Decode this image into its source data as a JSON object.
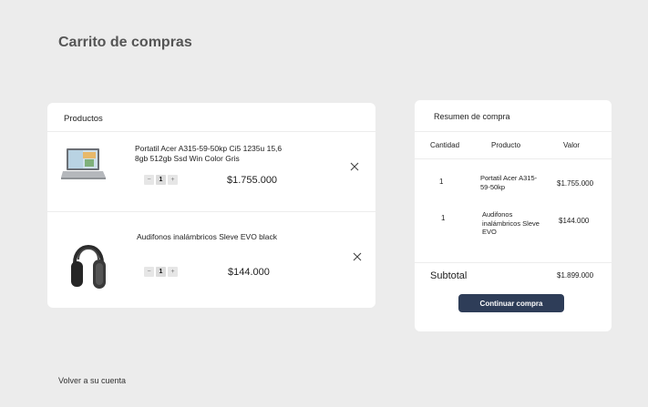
{
  "page": {
    "title": "Carrito de compras",
    "back_link": "Volver a  su cuenta"
  },
  "products": {
    "header": "Productos",
    "items": [
      {
        "name": "Portatil Acer A315-59-50kp Ci5 1235u 15,6 8gb 512gb Ssd Win Color Gris",
        "quantity": "1",
        "price": "$1.755.000",
        "image": "laptop-image"
      },
      {
        "name": "Audifonos inalámbricos Sleve EVO black",
        "quantity": "1",
        "price": "$144.000",
        "image": "headphones-image"
      }
    ],
    "minus_symbol": "−",
    "plus_symbol": "+"
  },
  "summary": {
    "title": "Resumen de compra",
    "columns": [
      "Cantidad",
      "Producto",
      "Valor"
    ],
    "rows": [
      {
        "qty": "1",
        "product": "Portatil Acer A315-59-50kp",
        "value": "$1.755.000"
      },
      {
        "qty": "1",
        "product": "Audifonos inalámbricos Sleve EVO",
        "value": "$144.000"
      }
    ],
    "subtotal_label": "Subtotal",
    "subtotal_value": "$1.899.000",
    "cta_label": "Continuar compra"
  },
  "colors": {
    "background": "#ececec",
    "card": "#ffffff",
    "cta": "#2e3d58"
  }
}
